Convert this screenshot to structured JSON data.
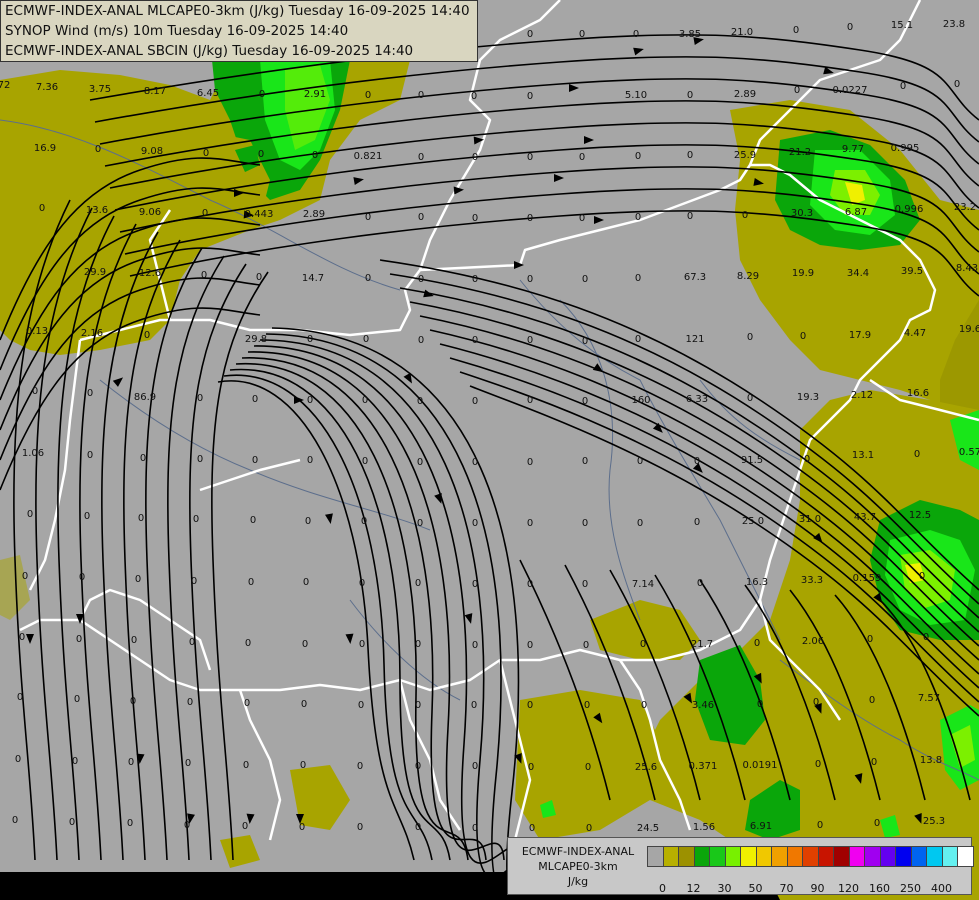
{
  "header": {
    "line1": "ECMWF-INDEX-ANAL MLCAPE0-3km (J/kg) Tuesday 16-09-2025 14:40",
    "line2": "SYNOP Wind (m/s) 10m Tuesday 16-09-2025 14:40",
    "line3": "ECMWF-INDEX-ANAL SBCIN (J/kg) Tuesday 16-09-2025 14:40"
  },
  "legend": {
    "line1": "ECMWF-INDEX-ANAL",
    "line2": "MLCAPE0-3km",
    "unit": "J/kg",
    "colors": [
      "#a6a6a6",
      "#b7b000",
      "#9c9100",
      "#0aa60a",
      "#19c819",
      "#78f000",
      "#f0f000",
      "#f0c800",
      "#f0a000",
      "#f07800",
      "#e04000",
      "#c81400",
      "#a00000",
      "#f000f0",
      "#a000f0",
      "#6400f0",
      "#0000f0",
      "#0064f0",
      "#00c8f0",
      "#64f0f0",
      "#ffffff"
    ],
    "ticks": [
      {
        "label": "0",
        "at": 1
      },
      {
        "label": "12",
        "at": 3
      },
      {
        "label": "30",
        "at": 5
      },
      {
        "label": "50",
        "at": 7
      },
      {
        "label": "70",
        "at": 9
      },
      {
        "label": "90",
        "at": 11
      },
      {
        "label": "120",
        "at": 13
      },
      {
        "label": "160",
        "at": 15
      },
      {
        "label": "250",
        "at": 17
      },
      {
        "label": "400",
        "at": 19
      }
    ]
  },
  "colors": {
    "background": "#a6a6a6",
    "olive": "#a8a400",
    "olive_dark": "#8f8c00",
    "green": "#0aa60a",
    "bright_green": "#19e619",
    "lime": "#7cf000",
    "yellow": "#f0f000",
    "border": "#ffffff",
    "streamline": "#000000",
    "river": "#5c6e8c"
  },
  "labels": [
    [
      "7.36",
      47,
      90
    ],
    [
      "3.75",
      100,
      92
    ],
    [
      "8.17",
      155,
      94
    ],
    [
      "6.45",
      208,
      96
    ],
    [
      "0",
      262,
      97
    ],
    [
      "2.91",
      315,
      97
    ],
    [
      "0",
      368,
      98
    ],
    [
      "0",
      421,
      98
    ],
    [
      "0",
      474,
      99
    ],
    [
      "0",
      530,
      99
    ],
    [
      "5.10",
      636,
      98
    ],
    [
      "0",
      690,
      98
    ],
    [
      "2.89",
      745,
      97
    ],
    [
      "0",
      797,
      93
    ],
    [
      "0.0227",
      850,
      93
    ],
    [
      "0",
      903,
      89
    ],
    [
      "0",
      957,
      87
    ],
    [
      "0",
      530,
      37
    ],
    [
      "0",
      582,
      37
    ],
    [
      "0",
      636,
      37
    ],
    [
      "3.85",
      690,
      37
    ],
    [
      "21.0",
      742,
      35
    ],
    [
      "0",
      796,
      33
    ],
    [
      "0",
      850,
      30
    ],
    [
      "15.1",
      902,
      28
    ],
    [
      "23.8",
      954,
      27
    ],
    [
      "16.9",
      45,
      151
    ],
    [
      "0",
      98,
      152
    ],
    [
      "9.08",
      152,
      154
    ],
    [
      "0",
      206,
      156
    ],
    [
      "0",
      261,
      157
    ],
    [
      "0",
      315,
      158
    ],
    [
      "0.821",
      368,
      159
    ],
    [
      "0",
      421,
      160
    ],
    [
      "0",
      475,
      160
    ],
    [
      "0",
      530,
      160
    ],
    [
      "0",
      582,
      160
    ],
    [
      "0",
      638,
      159
    ],
    [
      "0",
      690,
      158
    ],
    [
      "25.9",
      745,
      158
    ],
    [
      "21.2",
      800,
      155
    ],
    [
      "9.77",
      853,
      152
    ],
    [
      "0.995",
      905,
      151
    ],
    [
      "0",
      42,
      211
    ],
    [
      "13.6",
      97,
      213
    ],
    [
      "9.06",
      150,
      215
    ],
    [
      "0",
      205,
      216
    ],
    [
      "0.443",
      259,
      217
    ],
    [
      "2.89",
      314,
      217
    ],
    [
      "0",
      368,
      220
    ],
    [
      "0",
      421,
      220
    ],
    [
      "0",
      475,
      221
    ],
    [
      "0",
      530,
      221
    ],
    [
      "0",
      582,
      221
    ],
    [
      "0",
      638,
      220
    ],
    [
      "0",
      690,
      219
    ],
    [
      "0",
      745,
      218
    ],
    [
      "30.3",
      802,
      216
    ],
    [
      "6.87",
      856,
      215
    ],
    [
      "0.996",
      909,
      212
    ],
    [
      "23.2",
      965,
      210
    ],
    [
      "29.9",
      95,
      275
    ],
    [
      "12.6",
      150,
      276
    ],
    [
      "0",
      204,
      278
    ],
    [
      "0",
      259,
      280
    ],
    [
      "14.7",
      313,
      281
    ],
    [
      "0",
      368,
      281
    ],
    [
      "0",
      421,
      282
    ],
    [
      "0",
      475,
      282
    ],
    [
      "0",
      530,
      282
    ],
    [
      "0",
      585,
      282
    ],
    [
      "0",
      638,
      281
    ],
    [
      "67.3",
      695,
      280
    ],
    [
      "8.29",
      748,
      279
    ],
    [
      "19.9",
      803,
      276
    ],
    [
      "34.4",
      858,
      276
    ],
    [
      "39.5",
      912,
      274
    ],
    [
      "8.43",
      967,
      271
    ],
    [
      "0.13",
      37,
      334
    ],
    [
      "2.16",
      92,
      336
    ],
    [
      "0",
      147,
      338
    ],
    [
      "29.8",
      256,
      342
    ],
    [
      "0",
      310,
      342
    ],
    [
      "0",
      366,
      342
    ],
    [
      "0",
      421,
      343
    ],
    [
      "0",
      475,
      343
    ],
    [
      "0",
      530,
      343
    ],
    [
      "0",
      585,
      344
    ],
    [
      "0",
      638,
      342
    ],
    [
      "121",
      695,
      342
    ],
    [
      "0",
      750,
      340
    ],
    [
      "0",
      803,
      339
    ],
    [
      "17.9",
      860,
      338
    ],
    [
      "4.47",
      915,
      336
    ],
    [
      "19.6",
      970,
      332
    ],
    [
      "0",
      35,
      394
    ],
    [
      "0",
      90,
      396
    ],
    [
      "86.9",
      145,
      400
    ],
    [
      "0",
      200,
      401
    ],
    [
      "0",
      255,
      402
    ],
    [
      "0",
      310,
      403
    ],
    [
      "0",
      365,
      403
    ],
    [
      "0",
      420,
      404
    ],
    [
      "0",
      475,
      404
    ],
    [
      "0",
      530,
      403
    ],
    [
      "0",
      585,
      404
    ],
    [
      "160",
      641,
      403
    ],
    [
      "6.33",
      697,
      402
    ],
    [
      "0",
      750,
      401
    ],
    [
      "19.3",
      808,
      400
    ],
    [
      "2.12",
      862,
      398
    ],
    [
      "16.6",
      918,
      396
    ],
    [
      "1.06",
      33,
      456
    ],
    [
      "0",
      90,
      458
    ],
    [
      "0",
      143,
      461
    ],
    [
      "0",
      200,
      462
    ],
    [
      "0",
      255,
      463
    ],
    [
      "0",
      310,
      463
    ],
    [
      "0",
      365,
      464
    ],
    [
      "0",
      420,
      465
    ],
    [
      "0",
      475,
      465
    ],
    [
      "0",
      530,
      465
    ],
    [
      "0",
      585,
      464
    ],
    [
      "0",
      640,
      464
    ],
    [
      "0",
      697,
      464
    ],
    [
      "91.5",
      752,
      463
    ],
    [
      "0",
      807,
      462
    ],
    [
      "13.1",
      863,
      458
    ],
    [
      "0",
      917,
      457
    ],
    [
      "0.57",
      970,
      455
    ],
    [
      "0",
      30,
      517
    ],
    [
      "0",
      87,
      519
    ],
    [
      "0",
      141,
      521
    ],
    [
      "0",
      196,
      522
    ],
    [
      "0",
      253,
      523
    ],
    [
      "0",
      308,
      524
    ],
    [
      "0",
      364,
      524
    ],
    [
      "0",
      420,
      526
    ],
    [
      "0",
      475,
      526
    ],
    [
      "0",
      530,
      526
    ],
    [
      "0",
      585,
      526
    ],
    [
      "0",
      640,
      526
    ],
    [
      "0",
      697,
      525
    ],
    [
      "25.0",
      753,
      524
    ],
    [
      "31.0",
      810,
      522
    ],
    [
      "43.7",
      865,
      520
    ],
    [
      "12.5",
      920,
      518
    ],
    [
      "0",
      25,
      579
    ],
    [
      "0",
      82,
      580
    ],
    [
      "0",
      138,
      582
    ],
    [
      "0",
      194,
      584
    ],
    [
      "0",
      251,
      585
    ],
    [
      "0",
      306,
      585
    ],
    [
      "0",
      362,
      586
    ],
    [
      "0",
      418,
      586
    ],
    [
      "0",
      475,
      587
    ],
    [
      "0",
      530,
      587
    ],
    [
      "0",
      585,
      587
    ],
    [
      "7.14",
      643,
      587
    ],
    [
      "0",
      700,
      586
    ],
    [
      "16.3",
      757,
      585
    ],
    [
      "33.3",
      812,
      583
    ],
    [
      "0.159",
      867,
      581
    ],
    [
      "0",
      922,
      579
    ],
    [
      "0",
      22,
      640
    ],
    [
      "0",
      79,
      642
    ],
    [
      "0",
      134,
      643
    ],
    [
      "0",
      192,
      645
    ],
    [
      "0",
      248,
      646
    ],
    [
      "0",
      305,
      647
    ],
    [
      "0",
      362,
      647
    ],
    [
      "0",
      418,
      647
    ],
    [
      "0",
      475,
      648
    ],
    [
      "0",
      530,
      648
    ],
    [
      "0",
      586,
      648
    ],
    [
      "0",
      643,
      647
    ],
    [
      "21.7",
      702,
      647
    ],
    [
      "0",
      757,
      646
    ],
    [
      "2.06",
      813,
      644
    ],
    [
      "0",
      870,
      642
    ],
    [
      "0",
      926,
      640
    ],
    [
      "0",
      20,
      700
    ],
    [
      "0",
      77,
      702
    ],
    [
      "0",
      133,
      704
    ],
    [
      "0",
      190,
      705
    ],
    [
      "0",
      247,
      706
    ],
    [
      "0",
      304,
      707
    ],
    [
      "0",
      361,
      708
    ],
    [
      "0",
      418,
      708
    ],
    [
      "0",
      474,
      708
    ],
    [
      "0",
      530,
      708
    ],
    [
      "0",
      587,
      708
    ],
    [
      "0",
      644,
      708
    ],
    [
      "3.46",
      703,
      708
    ],
    [
      "0",
      760,
      707
    ],
    [
      "0",
      816,
      705
    ],
    [
      "0",
      872,
      703
    ],
    [
      "7.57",
      929,
      701
    ],
    [
      "0",
      18,
      762
    ],
    [
      "0",
      75,
      764
    ],
    [
      "0",
      131,
      765
    ],
    [
      "0",
      188,
      766
    ],
    [
      "0",
      246,
      768
    ],
    [
      "0",
      303,
      768
    ],
    [
      "0",
      360,
      769
    ],
    [
      "0",
      418,
      769
    ],
    [
      "0",
      475,
      769
    ],
    [
      "0",
      531,
      770
    ],
    [
      "0",
      588,
      770
    ],
    [
      "25.6",
      646,
      770
    ],
    [
      "0.371",
      703,
      769
    ],
    [
      "0.0191",
      760,
      768
    ],
    [
      "0",
      818,
      767
    ],
    [
      "0",
      874,
      765
    ],
    [
      "13.8",
      931,
      763
    ],
    [
      "0",
      15,
      823
    ],
    [
      "0",
      72,
      825
    ],
    [
      "0",
      130,
      826
    ],
    [
      "0",
      187,
      828
    ],
    [
      "0",
      245,
      829
    ],
    [
      "0",
      302,
      830
    ],
    [
      "0",
      360,
      830
    ],
    [
      "0",
      418,
      830
    ],
    [
      "0",
      475,
      831
    ],
    [
      "0",
      532,
      831
    ],
    [
      "0",
      589,
      831
    ],
    [
      "24.5",
      648,
      831
    ],
    [
      "1.56",
      704,
      830
    ],
    [
      "6.91",
      761,
      829
    ],
    [
      "0",
      820,
      828
    ],
    [
      "0",
      877,
      826
    ],
    [
      "25.3",
      934,
      824
    ],
    [
      "72",
      4,
      88
    ]
  ]
}
